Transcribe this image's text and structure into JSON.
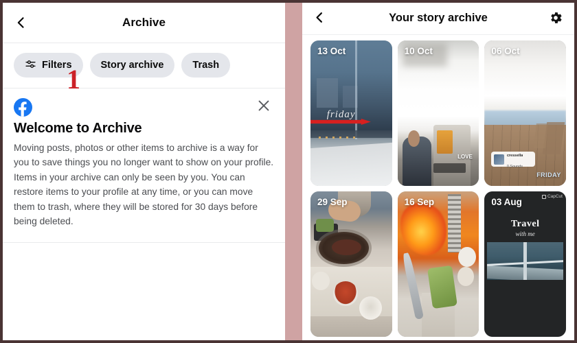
{
  "colors": {
    "outer_border": "#4a3434",
    "panel_divider": "#cfa3a3",
    "annotation_red": "#cc2127",
    "pill_bg": "#e4e6eb",
    "facebook_blue": "#1877f2"
  },
  "left_panel": {
    "header": {
      "back_icon": "chevron-left-icon",
      "title": "Archive"
    },
    "tabs": [
      {
        "label": "Filters",
        "icon": "tune-sliders-icon",
        "selected": false
      },
      {
        "label": "Story archive",
        "icon": "",
        "selected": true
      },
      {
        "label": "Trash",
        "icon": "",
        "selected": false
      }
    ],
    "annotation": {
      "step_number": "1",
      "targets": "Story archive"
    },
    "welcome_card": {
      "logo_icon": "facebook-logo-icon",
      "close_icon": "close-x-icon",
      "title": "Welcome to Archive",
      "body": "Moving posts, photos or other items to archive is a way for you to save things you no longer want to show on your profile. Items in your archive can only be seen by you. You can restore items to your profile at any time, or you can move them to trash, where they will be stored for 30 days before being deleted."
    }
  },
  "right_panel": {
    "header": {
      "back_icon": "chevron-left-icon",
      "title": "Your story archive",
      "settings_icon": "gear-icon"
    },
    "stories": [
      {
        "date": "13 Oct",
        "overlay_text": "friday",
        "has_annotation_arrow": true,
        "theme": "dusk-balcony-city-view"
      },
      {
        "date": "10 Oct",
        "overlay_text": "LOVE",
        "has_annotation_arrow": false,
        "theme": "bright-outdoor-person"
      },
      {
        "date": "06 Oct",
        "overlay_text": "FRIDAY",
        "music_sticker": {
          "name": "cressella",
          "subtitle": "0 Sounds"
        },
        "has_annotation_arrow": false,
        "theme": "wooden-deck-chairs"
      },
      {
        "date": "29 Sep",
        "overlay_text": "",
        "has_annotation_arrow": false,
        "theme": "korean-bbq-grill-table"
      },
      {
        "date": "16 Sep",
        "overlay_text": "",
        "has_annotation_arrow": false,
        "theme": "cooking-flame-wok"
      },
      {
        "date": "03 Aug",
        "overlay_text": "Travel",
        "overlay_subtext": "with me",
        "watermark": "CapCut",
        "has_annotation_arrow": false,
        "theme": "dark-travel-boat-clip"
      }
    ]
  }
}
